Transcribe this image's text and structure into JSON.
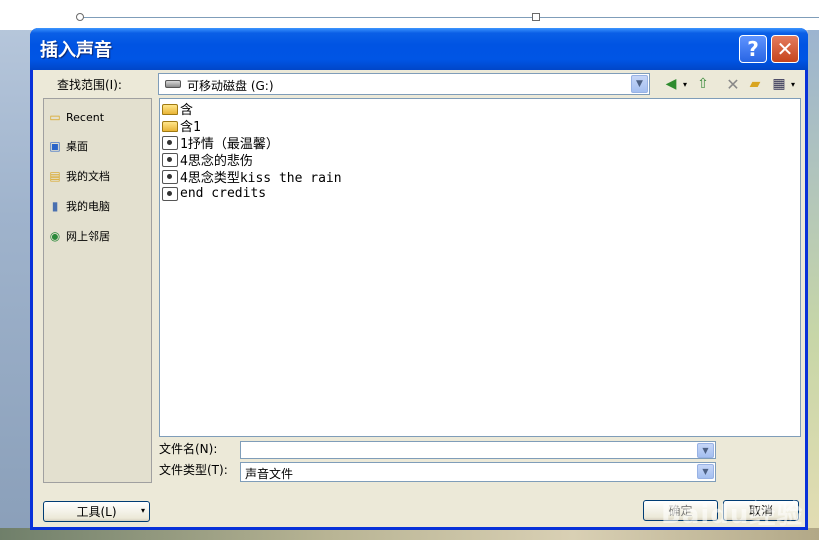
{
  "dialog": {
    "title": "插入声音",
    "help_label": "?",
    "close_label": "✕"
  },
  "lookin": {
    "label": "查找范围(I):",
    "value": "可移动磁盘 (G:)"
  },
  "places": [
    {
      "label": "Recent",
      "icon": "recent-folder-icon"
    },
    {
      "label": "桌面",
      "icon": "desktop-icon"
    },
    {
      "label": "我的文档",
      "icon": "my-documents-icon"
    },
    {
      "label": "我的电脑",
      "icon": "my-computer-icon"
    },
    {
      "label": "网上邻居",
      "icon": "network-icon"
    }
  ],
  "files": [
    {
      "name": "含",
      "type": "folder"
    },
    {
      "name": "含1",
      "type": "folder"
    },
    {
      "name": "1抒情（最温馨）",
      "type": "audio"
    },
    {
      "name": "4思念的悲伤",
      "type": "audio"
    },
    {
      "name": "4思念类型kiss the rain",
      "type": "audio"
    },
    {
      "name": "end credits",
      "type": "audio"
    }
  ],
  "filename": {
    "label": "文件名(N):",
    "value": ""
  },
  "filetype": {
    "label": "文件类型(T):",
    "value": "声音文件"
  },
  "buttons": {
    "tools": "工具(L)",
    "ok": "确定",
    "cancel": "取消"
  },
  "watermark": "Baidu经验"
}
